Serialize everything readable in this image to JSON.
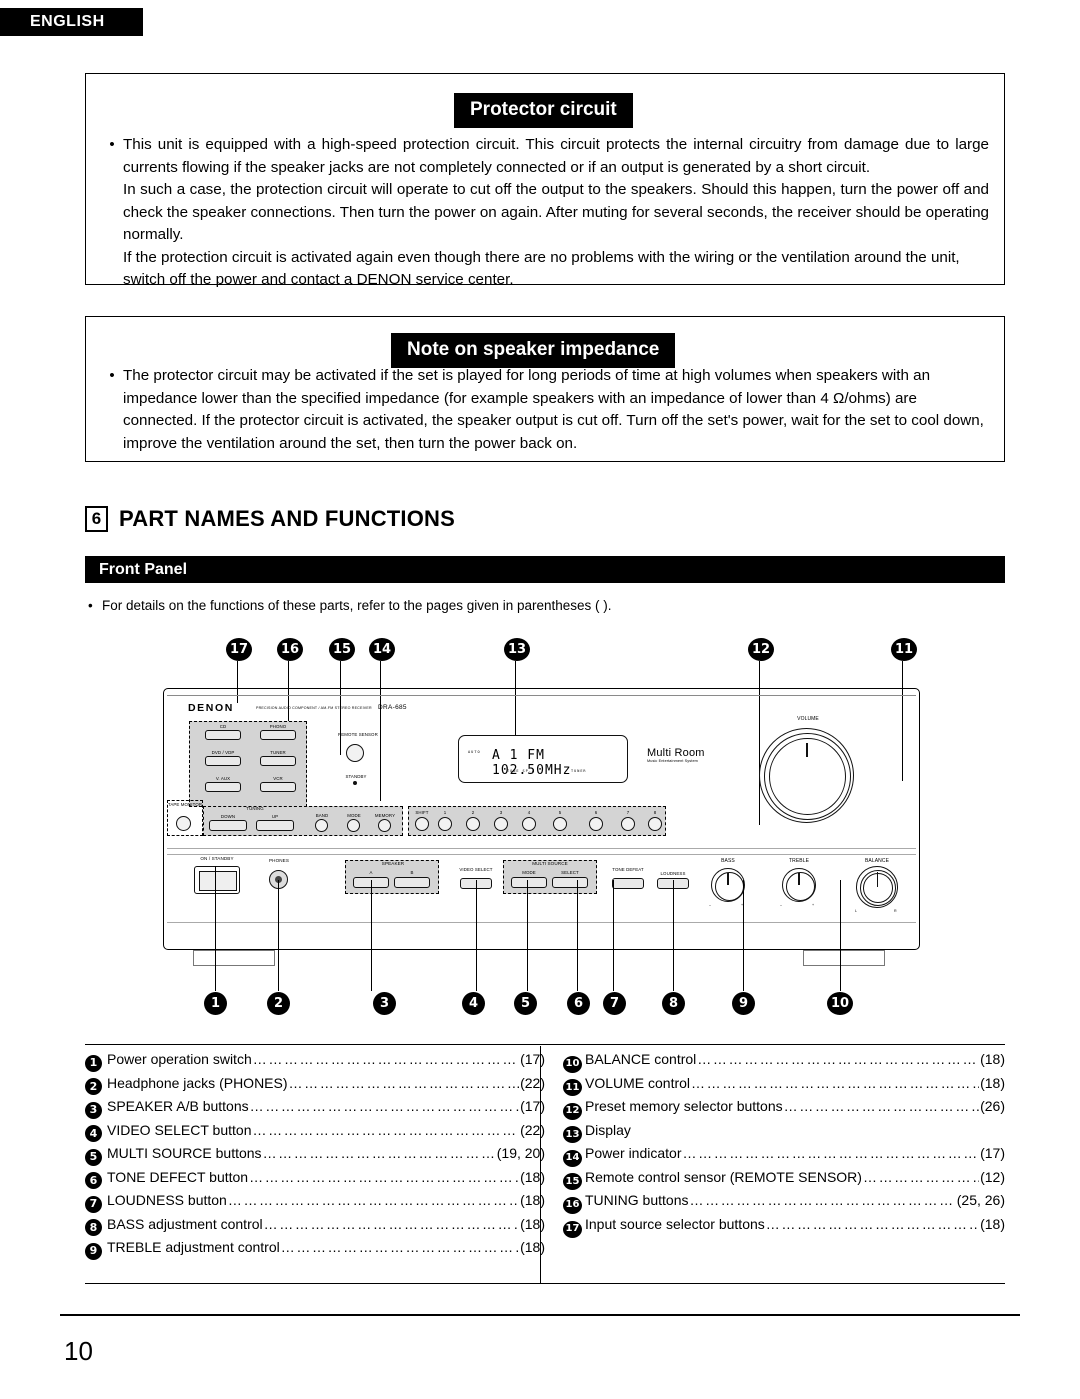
{
  "language_tab": "ENGLISH",
  "sections": {
    "protector": {
      "title": "Protector circuit",
      "bullet": "•",
      "paragraphs": [
        "This unit is equipped with a high-speed protection circuit. This circuit protects the internal circuitry from damage due to large currents flowing if the speaker jacks are not completely connected or if an output is generated by a short circuit.",
        "In such a case, the protection circuit will operate to cut off the output to the speakers. Should this happen, turn the power off and check the speaker connections. Then turn the power on again. After muting for several seconds, the receiver should be operating normally.",
        "If the protection circuit is activated again even though there are no problems with the wiring or the ventilation around the unit, switch off the power and contact a DENON service center."
      ]
    },
    "impedance": {
      "title": "Note on speaker impedance",
      "bullet": "•",
      "paragraphs": [
        "The protector circuit may be activated if the set is played for long periods of time at high volumes when speakers with an impedance lower than the specified impedance (for example speakers with an impedance of lower than 4 Ω/ohms) are connected. If the protector circuit is activated, the speaker output is cut off. Turn off the set's power, wait for the set to cool down, improve the ventilation around the set, then turn the power back on."
      ]
    }
  },
  "part_names": {
    "number": "6",
    "title": "PART NAMES AND FUNCTIONS",
    "subhead": "Front Panel",
    "note_bullet": "•",
    "note": "For details on the functions of these parts, refer to the pages given in parentheses (  )."
  },
  "diagram": {
    "top_callouts": [
      "17",
      "16",
      "15",
      "14",
      "13",
      "12",
      "11"
    ],
    "bottom_callouts": [
      "1",
      "2",
      "3",
      "4",
      "5",
      "6",
      "7",
      "8",
      "9",
      "10"
    ],
    "receiver": {
      "brand": "DENON",
      "brand_sub": "PRECISION AUDIO COMPONENT / AM-FM STEREO RECEIVER",
      "model": "DRA-685",
      "input_buttons": [
        "CD",
        "PHONO",
        "DVD / VDP",
        "TUNER",
        "V. AUX",
        "VCR"
      ],
      "tape_monitor": "TAPE MONITOR",
      "tuning_group": "TUNING",
      "tuning_buttons": [
        "DOWN",
        "UP"
      ],
      "tuner_buttons": [
        "BAND",
        "MODE",
        "MEMORY"
      ],
      "remote_sensor": "REMOTE SENSOR",
      "standby": "STANDBY",
      "display": {
        "auto": "AUTO",
        "main": "A 1  FM  102.50MHz",
        "sub_left": "TONE  SP-A",
        "sub_right": "TUNER"
      },
      "preset_labels": [
        "SHIFT",
        "1",
        "2",
        "3",
        "4",
        "5",
        "6",
        "7",
        "8"
      ],
      "multiroom_main": "Multi Room",
      "multiroom_sub": "Music Entertainment System",
      "volume_label": "VOLUME",
      "power_label": "ON / STANDBY",
      "phones_label": "PHONES",
      "speaker_group": "SPEAKER",
      "speaker_buttons": [
        "A",
        "B"
      ],
      "video_select": "VIDEO SELECT",
      "multi_source_group": "MULTI SOURCE",
      "multi_source_buttons": [
        "MODE",
        "SELECT"
      ],
      "tone_defeat": "TONE DEFEAT",
      "loudness": "LOUDNESS",
      "bass_label": "BASS",
      "treble_label": "TREBLE",
      "balance_label": "BALANCE",
      "tick_minus": "–",
      "tick_plus": "+",
      "tick_l": "L",
      "tick_r": "R"
    }
  },
  "legend": {
    "left": [
      {
        "num": "1",
        "label": "Power operation switch",
        "page": "(17)"
      },
      {
        "num": "2",
        "label": "Headphone jacks (PHONES)",
        "page": "(22)"
      },
      {
        "num": "3",
        "label": "SPEAKER A/B buttons",
        "page": "(17)"
      },
      {
        "num": "4",
        "label": "VIDEO SELECT button",
        "page": "(22)"
      },
      {
        "num": "5",
        "label": "MULTI SOURCE buttons",
        "page": "(19, 20)"
      },
      {
        "num": "6",
        "label": "TONE DEFECT button",
        "page": "(18)"
      },
      {
        "num": "7",
        "label": "LOUDNESS button",
        "page": "(18)"
      },
      {
        "num": "8",
        "label": "BASS adjustment control",
        "page": "(18)"
      },
      {
        "num": "9",
        "label": "TREBLE adjustment control",
        "page": "(18)"
      }
    ],
    "right": [
      {
        "num": "10",
        "label": "BALANCE control",
        "page": "(18)"
      },
      {
        "num": "11",
        "label": "VOLUME control",
        "page": "(18)"
      },
      {
        "num": "12",
        "label": "Preset memory selector buttons",
        "page": "(26)"
      },
      {
        "num": "13",
        "label": "Display",
        "page": ""
      },
      {
        "num": "14",
        "label": "Power indicator",
        "page": "(17)"
      },
      {
        "num": "15",
        "label": "Remote control sensor (REMOTE SENSOR)",
        "page": "(12)"
      },
      {
        "num": "16",
        "label": "TUNING buttons",
        "page": "(25, 26)"
      },
      {
        "num": "17",
        "label": "Input source selector buttons",
        "page": "(18)"
      }
    ]
  },
  "page_number": "10"
}
